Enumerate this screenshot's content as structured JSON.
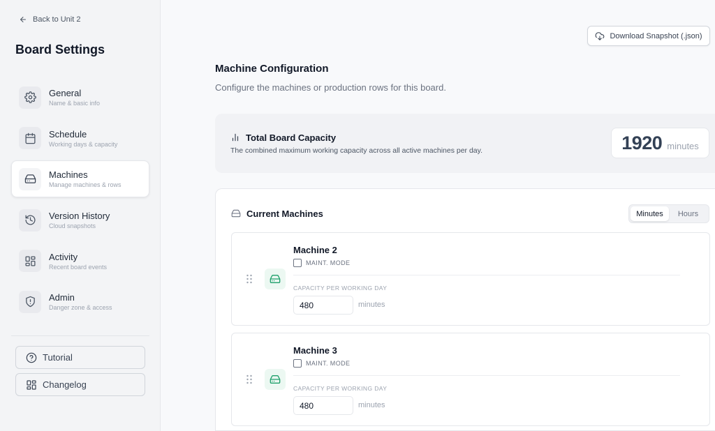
{
  "sidebar": {
    "back_label": "Back to Unit 2",
    "title": "Board Settings",
    "items": [
      {
        "label": "General",
        "sub": "Name & basic info",
        "icon": "gear-icon"
      },
      {
        "label": "Schedule",
        "sub": "Working days & capacity",
        "icon": "calendar-icon"
      },
      {
        "label": "Machines",
        "sub": "Manage machines & rows",
        "icon": "machine-icon",
        "active": true
      },
      {
        "label": "Version History",
        "sub": "Cloud snapshots",
        "icon": "history-icon"
      },
      {
        "label": "Activity",
        "sub": "Recent board events",
        "icon": "grid-icon"
      },
      {
        "label": "Admin",
        "sub": "Danger zone & access",
        "icon": "shield-icon"
      }
    ],
    "tutorial_label": "Tutorial",
    "changelog_label": "Changelog"
  },
  "header": {
    "download_label": "Download Snapshot (.json)"
  },
  "main": {
    "title": "Machine Configuration",
    "subtitle": "Configure the machines or production rows for this board.",
    "capacity": {
      "title": "Total Board Capacity",
      "description": "The combined maximum working capacity across all active machines per day.",
      "value": "1920",
      "unit": "minutes"
    },
    "machines_panel": {
      "title": "Current Machines",
      "toggle": {
        "options": [
          "Minutes",
          "Hours"
        ],
        "selected": "Minutes"
      },
      "machines": [
        {
          "name": "Machine 2",
          "maint_label": "MAINT. MODE",
          "capacity_label": "CAPACITY PER WORKING DAY",
          "capacity": "480",
          "unit": "minutes"
        },
        {
          "name": "Machine 3",
          "maint_label": "MAINT. MODE",
          "capacity_label": "CAPACITY PER WORKING DAY",
          "capacity": "480",
          "unit": "minutes"
        }
      ]
    }
  },
  "colors": {
    "accent_green": "#1fa06b",
    "text_dark": "#111827"
  }
}
